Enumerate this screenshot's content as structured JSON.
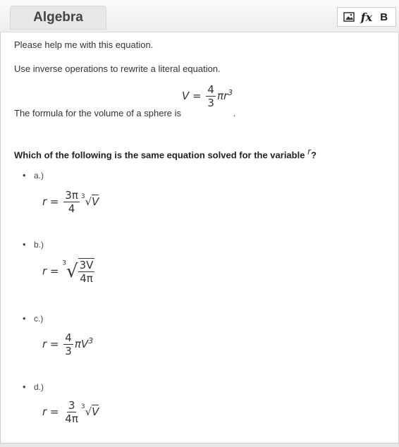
{
  "tab": {
    "label": "Algebra"
  },
  "toolbar": {
    "image_icon": "image-icon",
    "fx_label": "fx",
    "bold_label": "B"
  },
  "content": {
    "p1": "Please help me with this equation.",
    "p2": "Use inverse operations to rewrite a literal equation.",
    "formula_text": "The formula for the volume of a sphere is",
    "formula_period": ".",
    "formula": {
      "lhs": "V =",
      "num": "4",
      "den": "3",
      "rest": "πr",
      "exp": "3"
    },
    "question_start": "Which of the following is the same equation solved for the variable",
    "question_var": "r",
    "question_end": "?"
  },
  "options": [
    {
      "label": "a.)",
      "lhs": "r =",
      "num": "3π",
      "den": "4",
      "root_index": "3",
      "radicand": "V"
    },
    {
      "label": "b.)",
      "lhs": "r =",
      "root_index": "3",
      "num": "3V",
      "den": "4π"
    },
    {
      "label": "c.)",
      "lhs": "r =",
      "num": "4",
      "den": "3",
      "rest": "πV",
      "exp": "3"
    },
    {
      "label": "d.)",
      "lhs": "r =",
      "num": "3",
      "den": "4π",
      "root_index": "3",
      "radicand": "V"
    }
  ]
}
